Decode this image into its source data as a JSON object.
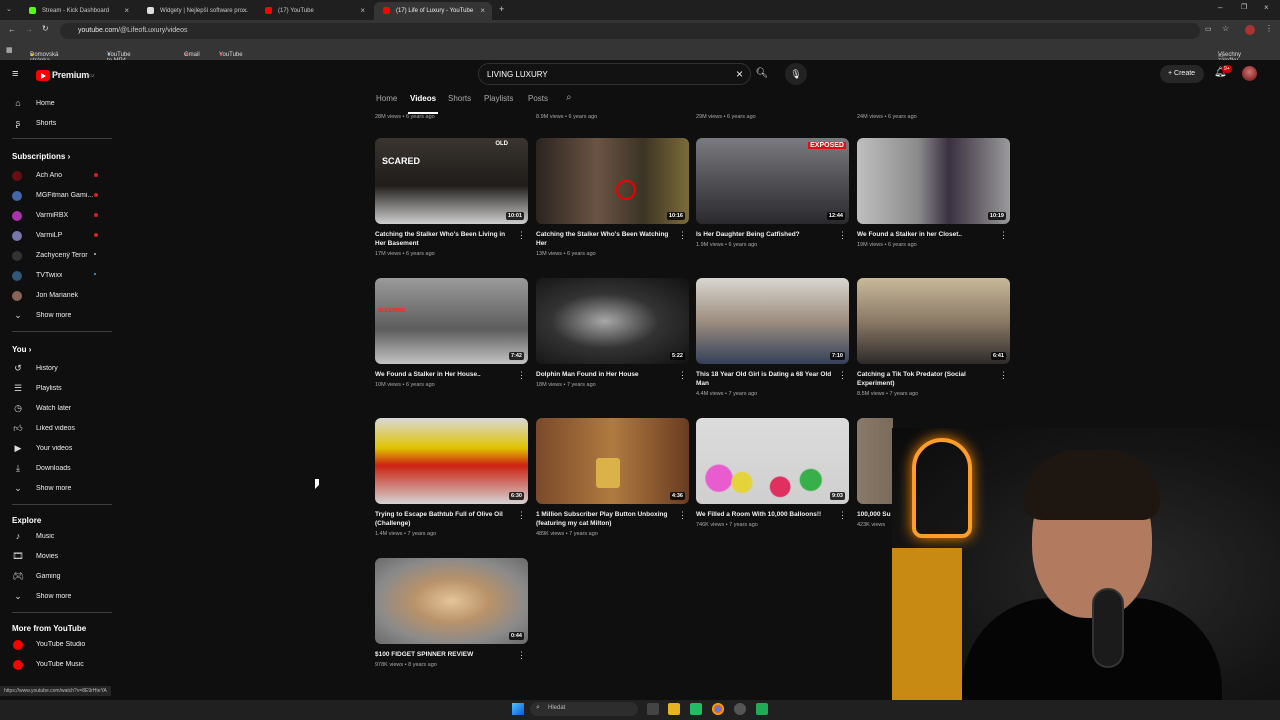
{
  "tabs": [
    {
      "label": "Stream - Kick Dashboard"
    },
    {
      "label": "Widgety | Nejlepší software pro..."
    },
    {
      "label": "(17) YouTube"
    },
    {
      "label": "(17) Life of Luxury - YouTube"
    }
  ],
  "address": {
    "host": "youtube.com",
    "path": "/@LifeofLuxury/videos"
  },
  "bookmarks": [
    {
      "label": "Domovská stránka..."
    },
    {
      "label": "YouTube to MP4 &..."
    },
    {
      "label": "Gmail"
    },
    {
      "label": "YouTube"
    },
    {
      "label": "Všechny záložky"
    }
  ],
  "header": {
    "logo_text": "Premium",
    "logo_sup": "CZ",
    "search_value": "LIVING LUXURY",
    "create_label": "Create",
    "notif_count": "9+"
  },
  "sidebar": {
    "top": [
      {
        "label": "Home"
      },
      {
        "label": "Shorts"
      }
    ],
    "subs_title": "Subscriptions",
    "subs": [
      {
        "label": "Ach Ano"
      },
      {
        "label": "MGFitman Gami..."
      },
      {
        "label": "VarmiRBX"
      },
      {
        "label": "VarmiLP"
      },
      {
        "label": "Zachycený Teror"
      },
      {
        "label": "TVTwixx"
      },
      {
        "label": "Jon Marianek"
      }
    ],
    "show_more": "Show more",
    "you_title": "You",
    "you": [
      {
        "label": "History"
      },
      {
        "label": "Playlists"
      },
      {
        "label": "Watch later"
      },
      {
        "label": "Liked videos"
      },
      {
        "label": "Your videos"
      },
      {
        "label": "Downloads"
      }
    ],
    "explore_title": "Explore",
    "explore": [
      {
        "label": "Music"
      },
      {
        "label": "Movies"
      },
      {
        "label": "Gaming"
      }
    ],
    "more_title": "More from YouTube",
    "more": [
      {
        "label": "YouTube Studio"
      },
      {
        "label": "YouTube Music"
      }
    ]
  },
  "channel_tabs": [
    "Home",
    "Videos",
    "Shorts",
    "Playlists",
    "Posts"
  ],
  "top_meta": [
    "28M views • 6 years ago",
    "8.9M views • 6 years ago",
    "29M views • 6 years ago",
    "24M views • 6 years ago"
  ],
  "videos": [
    {
      "title": "Catching the Stalker Who's Been Living in Her Basement",
      "meta": "17M views • 6 years ago",
      "duration": "10:01",
      "overlay": "SCARED",
      "overlay2": "OLD"
    },
    {
      "title": "Catching the Stalker Who's Been Watching Her",
      "meta": "13M views • 6 years ago",
      "duration": "10:16"
    },
    {
      "title": "Is Her Daughter Being Catfished?",
      "meta": "1.9M views • 6 years ago",
      "duration": "12:44",
      "overlay": "EXPOSED"
    },
    {
      "title": "We Found a Stalker in her Closet..",
      "meta": "19M views • 6 years ago",
      "duration": "10:19"
    },
    {
      "title": "We Found a Stalker in Her House..",
      "meta": "10M views • 6 years ago",
      "duration": "7:42",
      "overlay": "SLEEPING"
    },
    {
      "title": "Dolphin Man Found in Her House",
      "meta": "18M views • 7 years ago",
      "duration": "5:22"
    },
    {
      "title": "This 18 Year Old Girl is Dating a 68 Year Old Man",
      "meta": "4.4M views • 7 years ago",
      "duration": "7:10"
    },
    {
      "title": "Catching a Tik Tok Predator (Social Experiment)",
      "meta": "8.5M views • 7 years ago",
      "duration": "6:41"
    },
    {
      "title": "Trying to Escape Bathtub Full of Olive Oil (Challenge)",
      "meta": "1.4M views • 7 years ago",
      "duration": "6:30"
    },
    {
      "title": "1 Million Subscriber Play Button Unboxing (featuring my cat Milton)",
      "meta": "489K views • 7 years ago",
      "duration": "4:36"
    },
    {
      "title": "We Filled a Room With 10,000 Balloons!!",
      "meta": "746K views • 7 years ago",
      "duration": "9:03"
    },
    {
      "title": "100,000 Su",
      "meta": "423K views",
      "duration": ""
    },
    {
      "title": "$100 FIDGET SPINNER REVIEW",
      "meta": "978K views • 8 years ago",
      "duration": "0:44"
    }
  ],
  "status_url": "https://www.youtube.com/watch?v=8E9rHteYA",
  "taskbar": {
    "search_placeholder": "Hledat"
  }
}
